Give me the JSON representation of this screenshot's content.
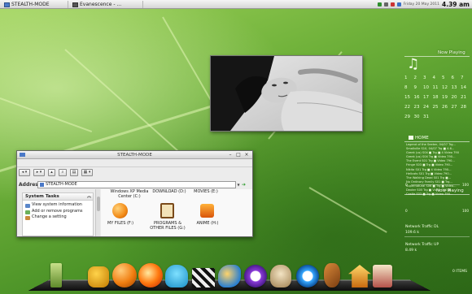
{
  "taskbar": {
    "windows": [
      {
        "label": "STEALTH-MODE",
        "icon": "folder-window-icon"
      },
      {
        "label": "Evanescence - ...",
        "icon": "media-player-icon"
      }
    ],
    "tray": {
      "date": "Friday 20 May 2011",
      "time": "4.39 am",
      "icons": [
        "network-icon",
        "volume-icon",
        "battery-icon",
        "update-icon"
      ]
    }
  },
  "sidebar": {
    "now_playing_title": "Now Playing",
    "music_icon": "music-note-icon",
    "calendar_numbers": [
      [
        "1",
        "2",
        "3",
        "4",
        "5",
        "6",
        "7"
      ],
      [
        "8",
        "9",
        "10",
        "11",
        "12",
        "13",
        "14"
      ],
      [
        "15",
        "16",
        "17",
        "18",
        "19",
        "20",
        "21"
      ],
      [
        "22",
        "23",
        "24",
        "25",
        "26",
        "27",
        "28"
      ],
      [
        "29",
        "30",
        "31"
      ]
    ],
    "home_label": "HOME",
    "feed_lines": [
      "Legend of the Seeker, 04/07 Trg...",
      "Smallville S10, 04/07 Trg ■ 4.6...",
      "Greek (us) S04 ■ Trg ■ 4 Video 790",
      "Greek (us) S04 Trg ■ Video 790...",
      "The Event S01 Trg ■ Video 790...",
      "Fringe S03 ■ Trg ■ Video 790...",
      "Nikita S01 Trg ■ 4 Video 790...",
      "Hellcats S01 Trg ■ Video 790...",
      "The Walking Dead S01 Trg ■...",
      "No Ordinary Family S01 ■ Trg...",
      "Supernatural S06 ■ Trg ■ Video...",
      "Dexter S05 Trg ■ Video 790 ■...",
      "Castle S03 ■ Trg ■ Video 790..."
    ],
    "scale_left": "0",
    "scale_right": "100",
    "now_playing2_title": "Now Playing",
    "net_dl_label": "Network Traffic DL",
    "net_dl_value": "109.6 k",
    "net_ul_label": "Network Traffic UP",
    "net_ul_value": "8.49 k",
    "items_count": "0 ITEMS"
  },
  "window": {
    "title": "STEALTH-MODE",
    "controls": [
      "minimize-icon",
      "maximize-icon",
      "close-icon"
    ],
    "toolbar": [
      {
        "label": "◂ ▾",
        "icon": "back-button"
      },
      {
        "label": "▸ ▾",
        "icon": "forward-button"
      },
      {
        "label": "▴",
        "icon": "up-button"
      },
      {
        "label": "⌕",
        "icon": "search-button"
      },
      {
        "label": "▤",
        "icon": "folders-button"
      },
      {
        "label": "▦ ▾",
        "icon": "views-button"
      }
    ],
    "address_label": "Address",
    "address_value": "STEALTH-MODE",
    "go_label": "Go",
    "system_tasks": {
      "title": "System Tasks",
      "items": [
        {
          "label": "View system information",
          "icon": "info-icon"
        },
        {
          "label": "Add or remove programs",
          "icon": "programs-icon"
        },
        {
          "label": "Change a setting",
          "icon": "control-panel-icon"
        }
      ]
    },
    "drives": [
      {
        "label": "Windows XP Media Center (C:)",
        "icon": ""
      },
      {
        "label": "DOWNLOAD (D:)",
        "icon": ""
      },
      {
        "label": "MOVIES (E:)",
        "icon": ""
      },
      {
        "label": "MY FILES (F:)",
        "icon": "orange-drive-icon"
      },
      {
        "label": "PROGRAMS & OTHER FILES (G:)",
        "icon": "scroll-drive-icon"
      },
      {
        "label": "ANIME (H:)",
        "icon": "fire-drive-icon"
      }
    ]
  },
  "dock": {
    "items": [
      {
        "name": "bamboo-lamp-icon"
      },
      {
        "name": "transformer-helmet-icon"
      },
      {
        "name": "billiard-ball-icon"
      },
      {
        "name": "fireball-icon"
      },
      {
        "name": "octopus-icon"
      },
      {
        "name": "clapperboard-icon"
      },
      {
        "name": "bird-icon"
      },
      {
        "name": "purple-ring-icon"
      },
      {
        "name": "skull-icon"
      },
      {
        "name": "blue-ring-icon"
      },
      {
        "name": "guitar-icon"
      },
      {
        "name": "pagoda-icon"
      },
      {
        "name": "recycle-bin-icon"
      }
    ]
  },
  "colors": {
    "desktop_green": "#6fb13a",
    "window_bg": "#ececec",
    "accent_orange": "#f28a16"
  }
}
